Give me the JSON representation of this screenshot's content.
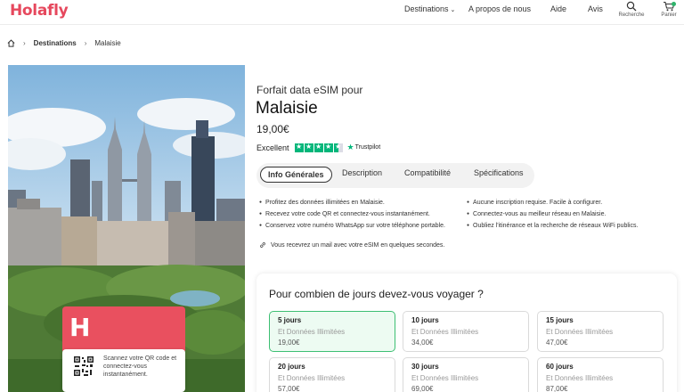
{
  "header": {
    "logo": "Holafly",
    "nav": {
      "destinations": "Destinations",
      "about": "A propos de nous",
      "help": "Aide",
      "reviews": "Avis"
    },
    "search_label": "Recherche",
    "cart_label": "Panier"
  },
  "breadcrumb": {
    "destinations": "Destinations",
    "current": "Malaisie"
  },
  "promo": {
    "logo_mark": "H",
    "text": "Scannez votre QR code et connectez-vous instantanément."
  },
  "product": {
    "subtitle": "Forfait data eSIM pour",
    "title": "Malaisie",
    "price": "19,00€",
    "rating_label": "Excellent",
    "rating_stars": 4.5,
    "trustpilot": "Trustpilot"
  },
  "tabs": [
    {
      "label": "Info Générales",
      "active": true
    },
    {
      "label": "Description",
      "active": false
    },
    {
      "label": "Compatibilité",
      "active": false
    },
    {
      "label": "Spécifications",
      "active": false
    }
  ],
  "features_left": [
    "Profitez des données illimitées en Malaisie.",
    "Recevez votre code QR et connectez-vous instantanément.",
    "Conservez votre numéro WhatsApp sur votre téléphone portable."
  ],
  "features_right": [
    "Aucune inscription requise. Facile à configurer.",
    "Connectez-vous au meilleur réseau en Malaisie.",
    "Oubliez l'itinérance et la recherche de réseaux WiFi publics."
  ],
  "notice": "Vous recevrez un mail avec votre eSIM en quelques secondes.",
  "days": {
    "title": "Pour combien de jours devez-vous voyager ?",
    "options": [
      {
        "days": "5 jours",
        "data": "Et Données Illimitées",
        "price": "19,00€",
        "selected": true
      },
      {
        "days": "10 jours",
        "data": "Et Données Illimitées",
        "price": "34,00€",
        "selected": false
      },
      {
        "days": "15 jours",
        "data": "Et Données Illimitées",
        "price": "47,00€",
        "selected": false
      },
      {
        "days": "20 jours",
        "data": "Et Données Illimitées",
        "price": "57,00€",
        "selected": false
      },
      {
        "days": "30 jours",
        "data": "Et Données Illimitées",
        "price": "69,00€",
        "selected": false
      },
      {
        "days": "60 jours",
        "data": "Et Données Illimitées",
        "price": "87,00€",
        "selected": false
      }
    ]
  },
  "colors": {
    "brand": "#e6485d",
    "trustpilot": "#00b67a",
    "selected_border": "#3dbf73",
    "selected_bg": "#edfbf2"
  }
}
